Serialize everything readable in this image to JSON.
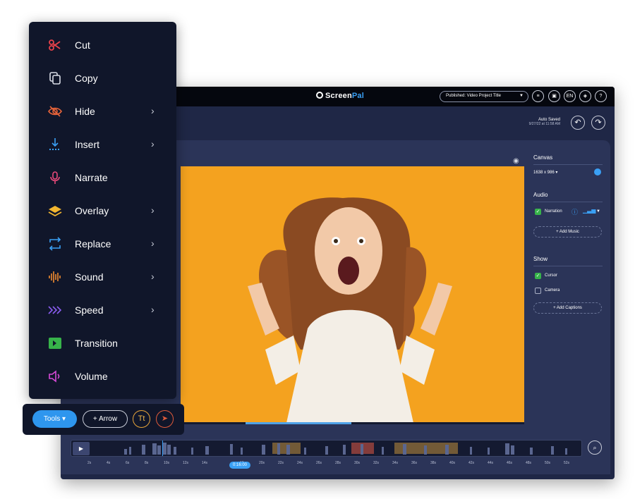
{
  "app": {
    "brand_screen": "Screen",
    "brand_pal": "Pal",
    "publish_label": "Published: Video Project Title",
    "language": "EN",
    "help": "?",
    "autosaved_label": "Auto Saved",
    "autosaved_time": "9/27/22 at 11:58 AM"
  },
  "panel": {
    "canvas_title": "Canvas",
    "canvas_size": "1638 x 986 ▾",
    "audio_title": "Audio",
    "narration": "Narration",
    "add_music": "+ Add Music",
    "show_title": "Show",
    "cursor": "Cursor",
    "camera": "Camera",
    "add_captions": "+ Add Captions"
  },
  "timeline": {
    "current_time": "0:16:00",
    "ticks": [
      "2s",
      "4s",
      "6s",
      "8s",
      "10s",
      "12s",
      "14s",
      "16s",
      "18s",
      "20s",
      "22s",
      "24s",
      "26s",
      "28s",
      "30s",
      "32s",
      "34s",
      "36s",
      "38s",
      "40s",
      "42s",
      "44s",
      "46s",
      "48s",
      "50s",
      "52s"
    ]
  },
  "menu": {
    "items": [
      {
        "label": "Cut",
        "icon": "scissors-icon",
        "color": "#e8424a",
        "submenu": false
      },
      {
        "label": "Copy",
        "icon": "copy-icon",
        "color": "#d8dce6",
        "submenu": false
      },
      {
        "label": "Hide",
        "icon": "eye-slash-icon",
        "color": "#e8643a",
        "submenu": true
      },
      {
        "label": "Insert",
        "icon": "insert-down-icon",
        "color": "#3aa0f5",
        "submenu": true
      },
      {
        "label": "Narrate",
        "icon": "microphone-icon",
        "color": "#e84a7a",
        "submenu": false
      },
      {
        "label": "Overlay",
        "icon": "layers-icon",
        "color": "#f2b630",
        "submenu": true
      },
      {
        "label": "Replace",
        "icon": "replace-icon",
        "color": "#3aa0f5",
        "submenu": true
      },
      {
        "label": "Sound",
        "icon": "sound-wave-icon",
        "color": "#f28c30",
        "submenu": true
      },
      {
        "label": "Speed",
        "icon": "speed-chevrons-icon",
        "color": "#8a5cf0",
        "submenu": true
      },
      {
        "label": "Transition",
        "icon": "transition-icon",
        "color": "#37b34a",
        "submenu": false
      },
      {
        "label": "Volume",
        "icon": "volume-icon",
        "color": "#d84ad8",
        "submenu": false
      }
    ]
  },
  "tools": {
    "tools_label": "Tools ▾",
    "arrow_label": "+ Arrow",
    "text_label": "Tt"
  }
}
